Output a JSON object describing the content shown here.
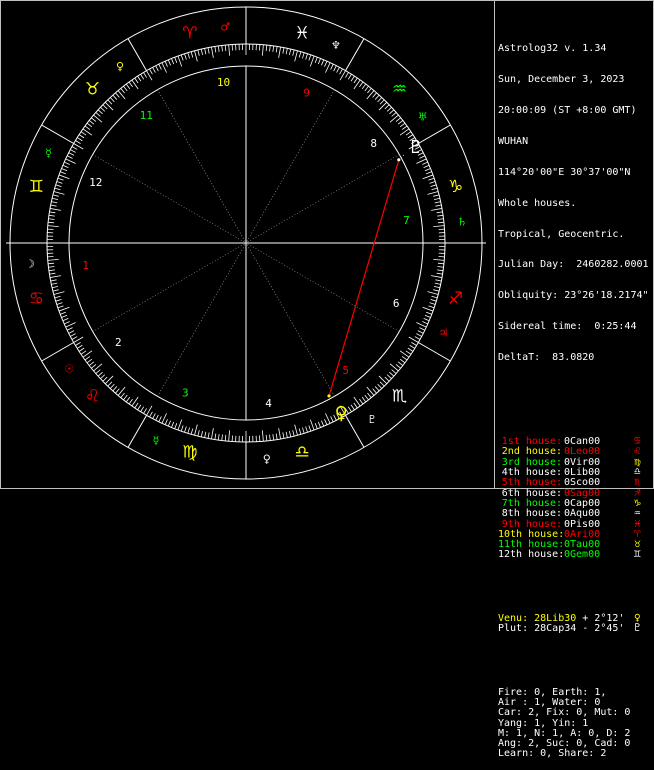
{
  "colors": {
    "white": "#ffffff",
    "red": "#ff0000",
    "dark_red": "#ff3030",
    "green": "#00ff00",
    "yellow": "#ffff00",
    "gray": "#c0c0c0",
    "pale_green": "#80ff80"
  },
  "header": {
    "lines": [
      "Astrolog32 v. 1.34",
      "Sun, December 3, 2023",
      "20:00:09 (ST +8:00 GMT)",
      "WUHAN",
      "114°20'00\"E 30°37'00\"N",
      "Whole houses.",
      "Tropical, Geocentric.",
      "Julian Day:  2460282.0001",
      "Obliquity: 23°26'18.2174\"",
      "Sidereal time:  0:25:44",
      "DeltaT:  83.0820"
    ]
  },
  "houses": [
    {
      "name": "1st house:",
      "value": "0Can00",
      "glyph": "♋",
      "name_color": "#ff0000",
      "value_color": "#ffffff",
      "glyph_color": "#ff0000"
    },
    {
      "name": "2nd house:",
      "value": "0Leo00",
      "glyph": "♌",
      "name_color": "#ffff00",
      "value_color": "#ff0000",
      "glyph_color": "#ff0000"
    },
    {
      "name": "3rd house:",
      "value": "0Vir00",
      "glyph": "♍",
      "name_color": "#00ff00",
      "value_color": "#ffffff",
      "glyph_color": "#ffff00"
    },
    {
      "name": "4th house:",
      "value": "0Lib00",
      "glyph": "♎",
      "name_color": "#ffffff",
      "value_color": "#ffffff",
      "glyph_color": "#ffffff"
    },
    {
      "name": "5th house:",
      "value": "0Sco00",
      "glyph": "♏",
      "name_color": "#ff0000",
      "value_color": "#ffffff",
      "glyph_color": "#ff0000"
    },
    {
      "name": "6th house:",
      "value": "0Sag00",
      "glyph": "♐",
      "name_color": "#ffffff",
      "value_color": "#ff0000",
      "glyph_color": "#ff0000"
    },
    {
      "name": "7th house:",
      "value": "0Cap00",
      "glyph": "♑",
      "name_color": "#00ff00",
      "value_color": "#ffffff",
      "glyph_color": "#ffff00"
    },
    {
      "name": "8th house:",
      "value": "0Aqu00",
      "glyph": "♒",
      "name_color": "#ffffff",
      "value_color": "#ffffff",
      "glyph_color": "#ffffff"
    },
    {
      "name": "9th house:",
      "value": "0Pis00",
      "glyph": "♓",
      "name_color": "#ff0000",
      "value_color": "#ffffff",
      "glyph_color": "#ff0000"
    },
    {
      "name": "10th house:",
      "value": "0Ari00",
      "glyph": "♈",
      "name_color": "#ffff00",
      "value_color": "#ff0000",
      "glyph_color": "#ff0000"
    },
    {
      "name": "11th house:",
      "value": "0Tau00",
      "glyph": "♉",
      "name_color": "#00ff00",
      "value_color": "#00ff00",
      "glyph_color": "#ffff00"
    },
    {
      "name": "12th house:",
      "value": "0Gem00",
      "glyph": "♊",
      "name_color": "#ffffff",
      "value_color": "#00ff00",
      "glyph_color": "#ffffff"
    }
  ],
  "aspect_planets": [
    {
      "label": "Venu:",
      "position": "28Lib30",
      "extra": "+ 2°12'",
      "glyph": "♀",
      "color": "#ffff00"
    },
    {
      "label": "Plut:",
      "position": "28Cap34",
      "extra": "- 2°45'",
      "glyph": "♇",
      "color": "#ffffff"
    }
  ],
  "stats": [
    "Fire: 0, Earth: 1,",
    "Air : 1, Water: 0",
    "Car: 2, Fix: 0, Mut: 0",
    "Yang: 1, Yin: 1",
    "M: 1, N: 1, A: 0, D: 2",
    "Ang: 2, Suc: 0, Cad: 0",
    "Learn: 0, Share: 2"
  ],
  "wheel": {
    "house_numbers": [
      "1",
      "2",
      "3",
      "4",
      "5",
      "6",
      "7",
      "8",
      "9",
      "10",
      "11",
      "12"
    ],
    "house_number_colors": [
      "#ff0000",
      "#ffffff",
      "#00ff00",
      "#ffffff",
      "#ff0000",
      "#ffffff",
      "#00ff00",
      "#ffffff",
      "#ff0000",
      "#ffff00",
      "#00ff00",
      "#ffffff"
    ],
    "zodiac_signs": [
      {
        "glyph": "♋",
        "color": "#ff0000"
      },
      {
        "glyph": "♌",
        "color": "#ff0000"
      },
      {
        "glyph": "♍",
        "color": "#ffff00"
      },
      {
        "glyph": "♎",
        "color": "#ffff00"
      },
      {
        "glyph": "♏",
        "color": "#ffffff"
      },
      {
        "glyph": "♐",
        "color": "#ff0000"
      },
      {
        "glyph": "♑",
        "color": "#ffff00"
      },
      {
        "glyph": "♒",
        "color": "#00ff00"
      },
      {
        "glyph": "♓",
        "color": "#ffffff"
      },
      {
        "glyph": "♈",
        "color": "#ff0000"
      },
      {
        "glyph": "♉",
        "color": "#ffff00"
      },
      {
        "glyph": "♊",
        "color": "#ffff00"
      }
    ],
    "rulers": [
      {
        "glyph": "☽",
        "color": "#ffffff"
      },
      {
        "glyph": "☉",
        "color": "#ff0000"
      },
      {
        "glyph": "☿",
        "color": "#00ff00"
      },
      {
        "glyph": "♀",
        "color": "#ffffff"
      },
      {
        "glyph": "♇",
        "color": "#ffffff"
      },
      {
        "glyph": "♃",
        "color": "#ff0000"
      },
      {
        "glyph": "♄",
        "color": "#00ff00"
      },
      {
        "glyph": "♅",
        "color": "#00ff00"
      },
      {
        "glyph": "♆",
        "color": "#ffffff"
      },
      {
        "glyph": "♂",
        "color": "#ff0000"
      },
      {
        "glyph": "♀",
        "color": "#ffff00"
      },
      {
        "glyph": "☿",
        "color": "#00ff00"
      }
    ],
    "planets": [
      {
        "name": "venus",
        "glyph": "♀",
        "color": "#ffff00"
      },
      {
        "name": "pluto",
        "glyph": "♇",
        "color": "#ffffff"
      }
    ]
  }
}
